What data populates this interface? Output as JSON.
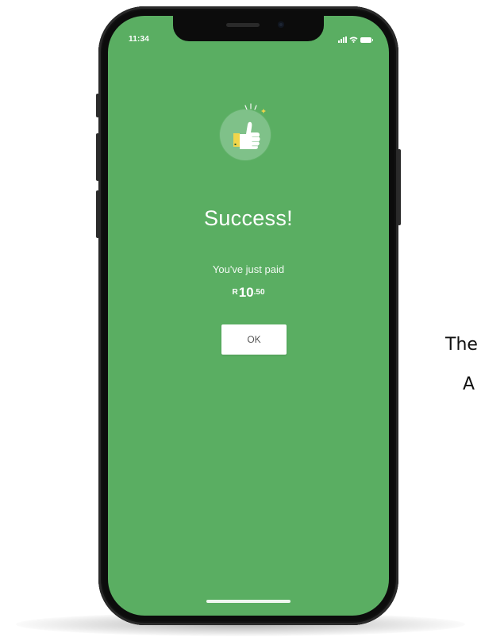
{
  "status_bar": {
    "time": "11:34",
    "icons": [
      "signal-icon",
      "wifi-icon",
      "battery-icon"
    ]
  },
  "success_screen": {
    "icon": "thumbs-up-icon",
    "title": "Success!",
    "message": "You've just paid",
    "amount": {
      "currency": "R",
      "major": "10",
      "minor": ".50"
    },
    "ok_button_label": "OK"
  },
  "side_text": {
    "line1": "The",
    "line2": "A"
  },
  "colors": {
    "screen_background": "#5aae62",
    "badge_background": "#7fc189",
    "thumb_yellow": "#f0d54a",
    "button_text": "#555555"
  }
}
